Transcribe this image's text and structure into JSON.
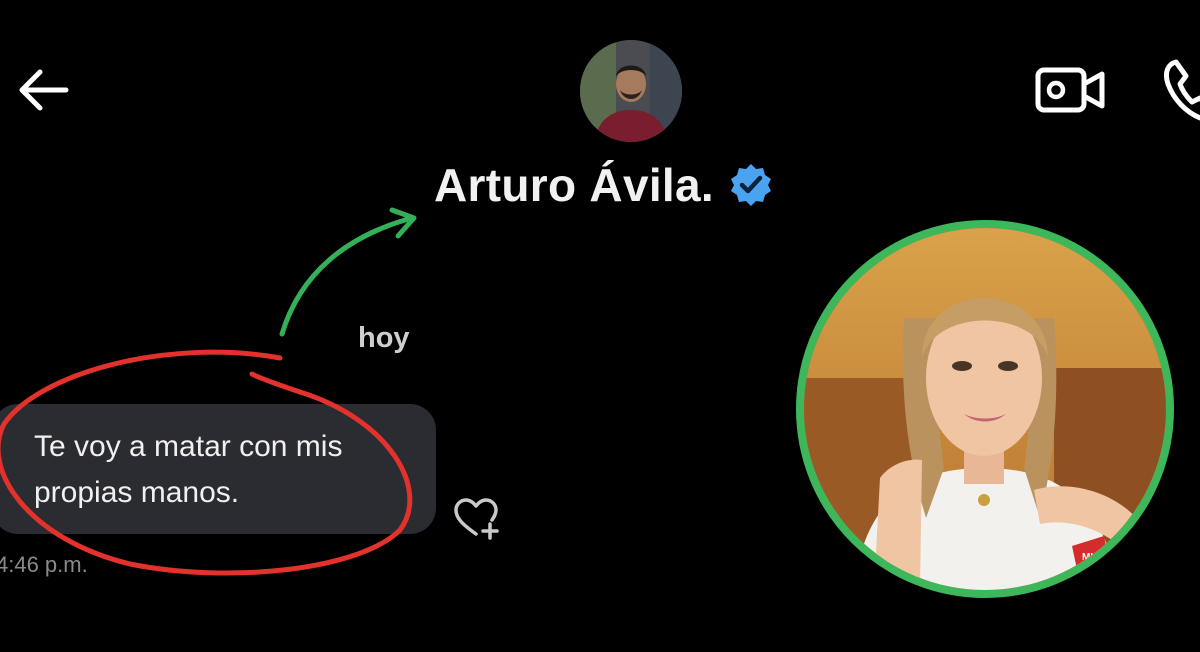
{
  "header": {
    "contact_name": "Arturo Ávila.",
    "verified": true,
    "back_icon": "arrow-left-icon",
    "video_icon": "video-camera-icon",
    "call_icon": "phone-icon",
    "verified_icon": "verified-badge-icon",
    "verified_color": "#4aa3f0"
  },
  "conversation": {
    "day_label": "hoy",
    "messages": [
      {
        "text": "Te voy a matar con mis propias manos.",
        "time": "4:46 p.m.",
        "react_icon": "heart-plus-icon"
      }
    ]
  },
  "annotations": {
    "highlight_color": "#e2322b",
    "arrow_color": "#35b05a"
  },
  "inset": {
    "ring_color": "#3db75a",
    "badge_text": "MH"
  }
}
